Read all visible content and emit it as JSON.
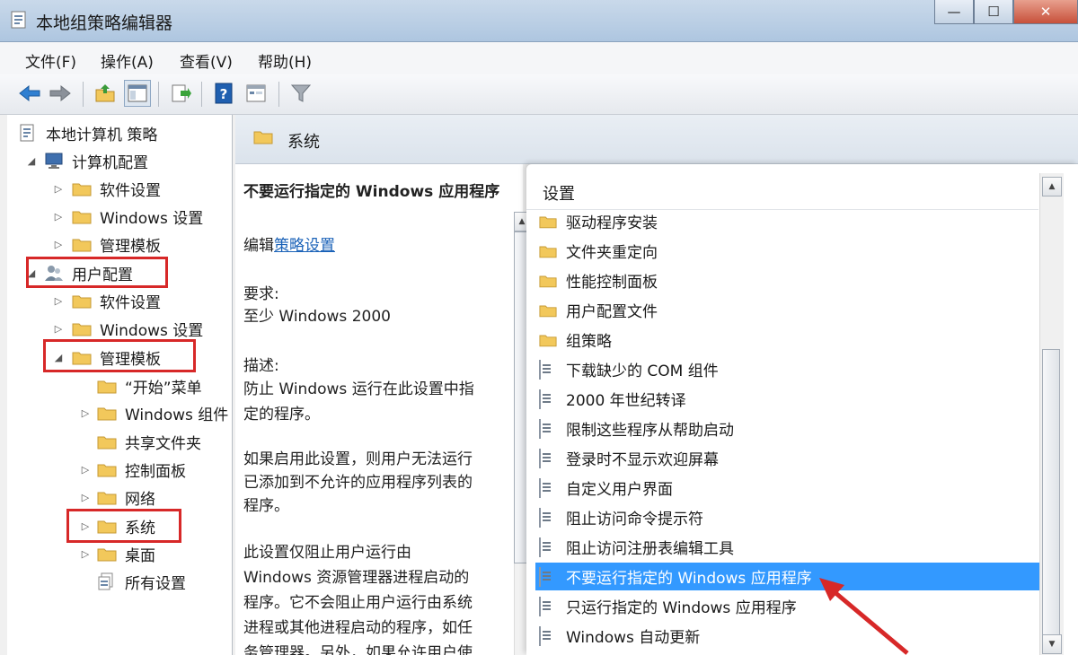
{
  "window": {
    "title": "本地组策略编辑器",
    "icon": "policy-editor-icon",
    "minimize": "—",
    "maximize": "☐",
    "close": "✕"
  },
  "menu": [
    {
      "label": "文件(F)"
    },
    {
      "label": "操作(A)"
    },
    {
      "label": "查看(V)"
    },
    {
      "label": "帮助(H)"
    }
  ],
  "toolbar": [
    "back-icon",
    "forward-icon",
    "up-folder-icon",
    "show-hide-tree-icon",
    "export-list-icon",
    "help-icon",
    "properties-icon",
    "filter-icon"
  ],
  "tree": {
    "root": "本地计算机 策略",
    "computer_config": "计算机配置",
    "cc_software": "软件设置",
    "cc_windows": "Windows 设置",
    "cc_admin": "管理模板",
    "user_config": "用户配置",
    "uc_software": "软件设置",
    "uc_windows": "Windows 设置",
    "uc_admin": "管理模板",
    "start_menu": "“开始”菜单",
    "windows_components": "Windows 组件",
    "shared_folders": "共享文件夹",
    "control_panel": "控制面板",
    "network": "网络",
    "system": "系统",
    "desktop": "桌面",
    "all_settings": "所有设置"
  },
  "header": {
    "title": "系统"
  },
  "description": {
    "policy_title": "不要运行指定的 Windows 应用程序",
    "edit_prefix": "编辑",
    "edit_link": "策略设置",
    "req_label": "要求:",
    "req_value": "至少 Windows 2000",
    "desc_label": "描述:",
    "desc_line1": "防止 Windows 运行在此设置中指",
    "desc_line2": "定的程序。",
    "p2_line1": "如果启用此设置，则用户无法运行",
    "p2_line2": "已添加到不允许的应用程序列表的",
    "p2_line3": "程序。",
    "p3_line1": "此设置仅阻止用户运行由",
    "p3_line2": "Windows 资源管理器进程启动的",
    "p3_line3": "程序。它不会阻止用户运行由系统",
    "p3_line4": "进程或其他进程启动的程序，如任",
    "p3_line5": "务管理器。另外，如果允许用户使"
  },
  "list": {
    "column_header": "设置",
    "items": [
      {
        "label": "驱动程序安装",
        "type": "folder"
      },
      {
        "label": "文件夹重定向",
        "type": "folder"
      },
      {
        "label": "性能控制面板",
        "type": "folder"
      },
      {
        "label": "用户配置文件",
        "type": "folder"
      },
      {
        "label": "组策略",
        "type": "folder"
      },
      {
        "label": "下载缺少的 COM 组件",
        "type": "policy"
      },
      {
        "label": "2000 年世纪转译",
        "type": "policy"
      },
      {
        "label": "限制这些程序从帮助启动",
        "type": "policy"
      },
      {
        "label": "登录时不显示欢迎屏幕",
        "type": "policy"
      },
      {
        "label": "自定义用户界面",
        "type": "policy"
      },
      {
        "label": "阻止访问命令提示符",
        "type": "policy"
      },
      {
        "label": "阻止访问注册表编辑工具",
        "type": "policy"
      },
      {
        "label": "不要运行指定的 Windows 应用程序",
        "type": "policy",
        "selected": true
      },
      {
        "label": "只运行指定的 Windows 应用程序",
        "type": "policy"
      },
      {
        "label": "Windows 自动更新",
        "type": "policy"
      }
    ]
  },
  "colors": {
    "highlight": "#3399ff",
    "annotation": "#d72828",
    "folder": "#f2c85b"
  }
}
